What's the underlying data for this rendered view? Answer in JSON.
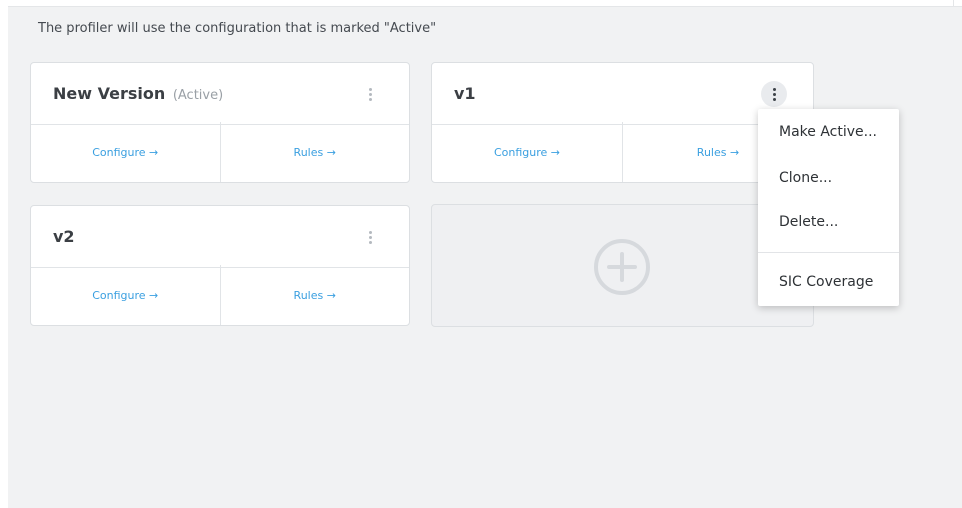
{
  "intro_text": "The profiler will use the configuration that is marked \"Active\"",
  "cards": [
    {
      "title": "New Version",
      "status": "(Active)",
      "configure_label": "Configure →",
      "rules_label": "Rules →"
    },
    {
      "title": "v1",
      "status": "",
      "configure_label": "Configure →",
      "rules_label": "Rules →"
    },
    {
      "title": "v2",
      "status": "",
      "configure_label": "Configure →",
      "rules_label": "Rules →"
    }
  ],
  "add_card": {
    "icon": "plus-circle-icon"
  },
  "context_menu": {
    "items": [
      "Make Active...",
      "Clone...",
      "Delete...",
      "SIC Coverage"
    ]
  },
  "colors": {
    "link": "#3a9fe0",
    "background": "#f1f2f3",
    "card": "#ffffff",
    "muted": "#9aa0a6"
  }
}
